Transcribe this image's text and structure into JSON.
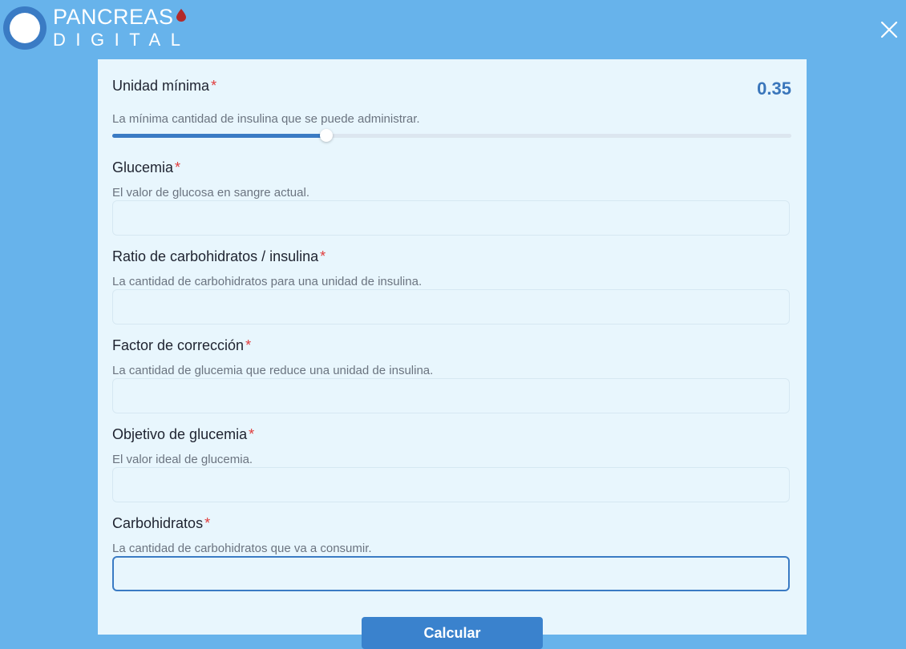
{
  "brand": {
    "line1": "PANCREAS",
    "line2": "DIGITAL",
    "ring_color": "#3a7bc4",
    "drop_color": "#b22a2a"
  },
  "header": {
    "close_icon": "close-icon"
  },
  "form": {
    "unidad_minima": {
      "label": "Unidad mínima",
      "required_mark": "*",
      "help": "La mínima cantidad de insulina que se puede administrar.",
      "value_display": "0.35",
      "slider_fraction": 0.315
    },
    "glucemia": {
      "label": "Glucemia",
      "required_mark": "*",
      "help": "El valor de glucosa en sangre actual.",
      "value": ""
    },
    "ratio": {
      "label": "Ratio de carbohidratos / insulina",
      "required_mark": "*",
      "help": "La cantidad de carbohidratos para una unidad de insulina.",
      "value": ""
    },
    "factor": {
      "label": "Factor de corrección",
      "required_mark": "*",
      "help": "La cantidad de glucemia que reduce una unidad de insulina.",
      "value": ""
    },
    "objetivo": {
      "label": "Objetivo de glucemia",
      "required_mark": "*",
      "help": "El valor ideal de glucemia.",
      "value": ""
    },
    "carbohidratos": {
      "label": "Carbohidratos",
      "required_mark": "*",
      "help": "La cantidad de carbohidratos que va a consumir.",
      "value": ""
    },
    "submit_label": "Calcular"
  },
  "colors": {
    "background": "#67b3eb",
    "panel": "#e8f6fd",
    "accent": "#3a7bc4",
    "required": "#e03b3b"
  }
}
